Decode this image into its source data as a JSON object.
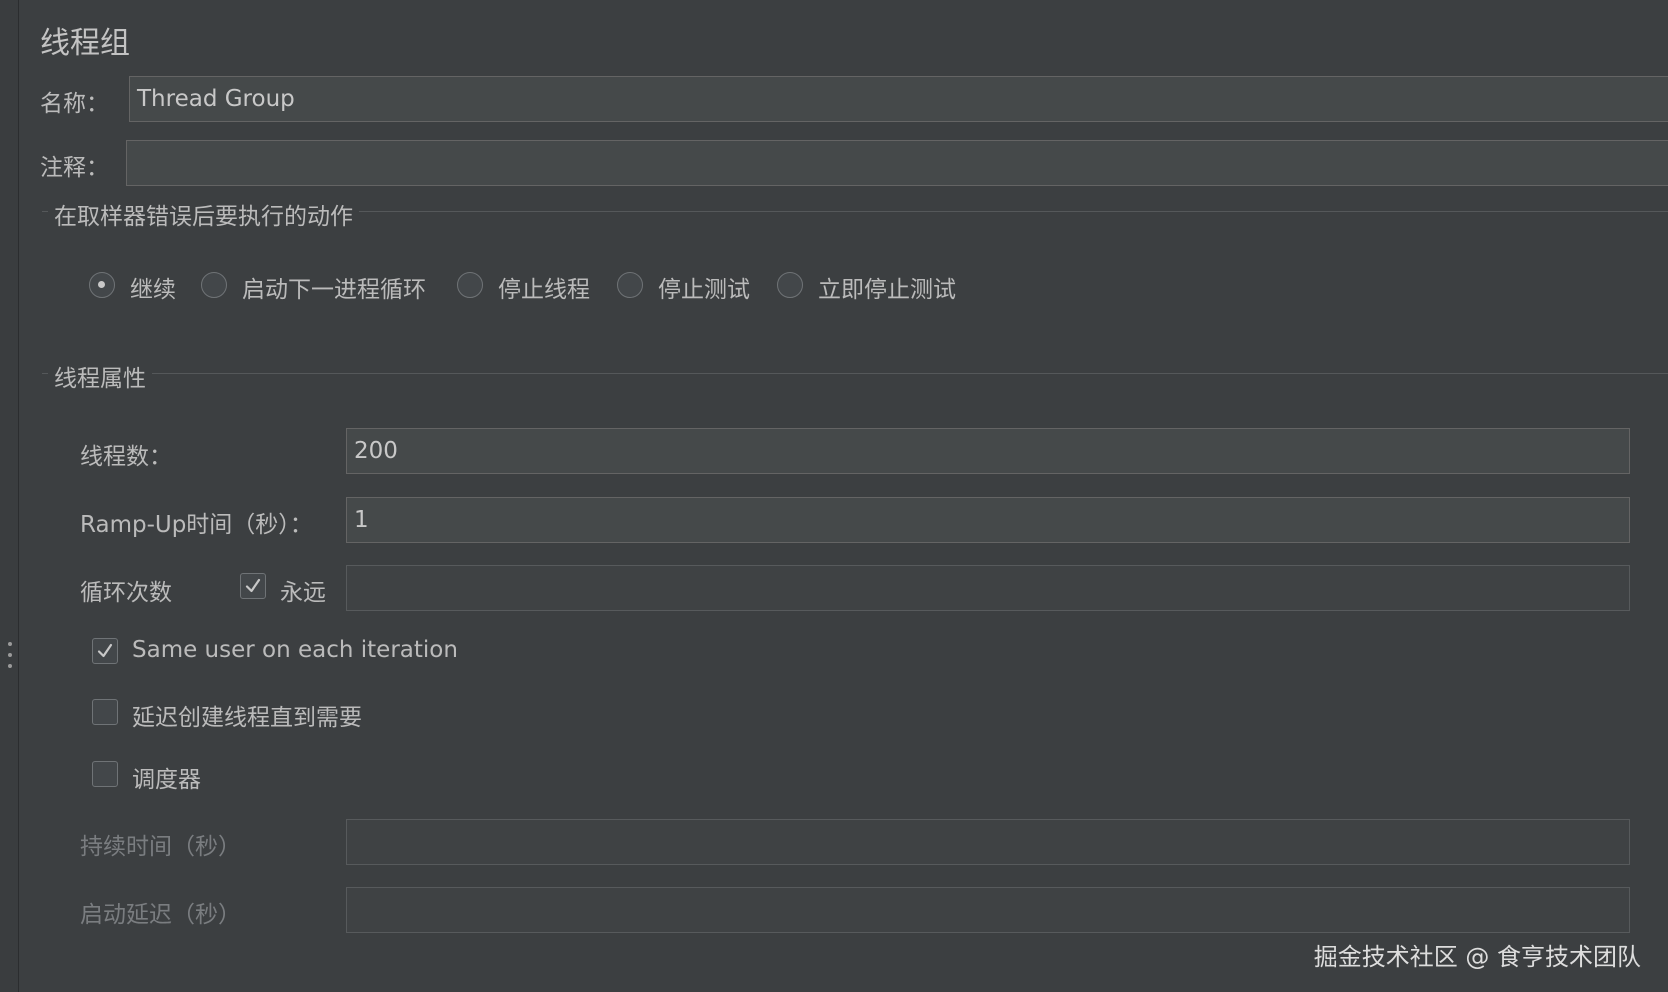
{
  "panel": {
    "title": "线程组"
  },
  "name_field": {
    "label": "名称：",
    "value": "Thread Group"
  },
  "comment_field": {
    "label": "注释：",
    "value": ""
  },
  "sampler_error": {
    "title": "在取样器错误后要执行的动作",
    "options": [
      {
        "label": "继续",
        "selected": true
      },
      {
        "label": "启动下一进程循环",
        "selected": false
      },
      {
        "label": "停止线程",
        "selected": false
      },
      {
        "label": "停止测试",
        "selected": false
      },
      {
        "label": "立即停止测试",
        "selected": false
      }
    ]
  },
  "thread_props": {
    "title": "线程属性",
    "threads": {
      "label": "线程数：",
      "value": "200"
    },
    "ramp_up": {
      "label": "Ramp-Up时间（秒）：",
      "value": "1"
    },
    "loop": {
      "label": "循环次数",
      "forever_label": "永远",
      "forever_checked": true,
      "value": ""
    },
    "same_user": {
      "label": "Same user on each iteration",
      "checked": true
    },
    "delay_create": {
      "label": "延迟创建线程直到需要",
      "checked": false
    },
    "scheduler": {
      "label": "调度器",
      "checked": false
    },
    "duration": {
      "label": "持续时间（秒）",
      "value": ""
    },
    "startup_delay": {
      "label": "启动延迟（秒）",
      "value": ""
    }
  },
  "watermark": "掘金技术社区 @ 食亨技术团队",
  "colors": {
    "background": "#3c3f41",
    "field": "#45494a",
    "text": "#bbbbbb",
    "disabled_text": "#7a7d80"
  }
}
